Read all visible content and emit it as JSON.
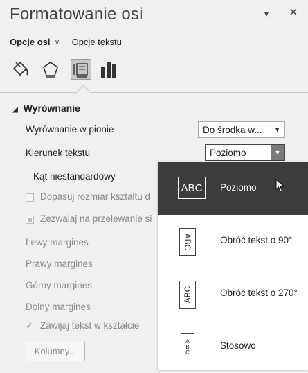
{
  "title": "Formatowanie osi",
  "title_controls": {
    "dropdown_glyph": "▾",
    "close_glyph": "×"
  },
  "tabs": {
    "main": "Opcje osi",
    "secondary": "Opcje tekstu"
  },
  "icons": [
    "fill-line-icon",
    "effects-icon",
    "size-properties-icon",
    "axis-options-icon"
  ],
  "section": {
    "label": "Wyrównanie"
  },
  "fields": {
    "vertical_align": {
      "label": "Wyrównanie w pionie",
      "value": "Do środka w..."
    },
    "text_direction": {
      "label": "Kierunek tekstu",
      "value": "Poziomo"
    },
    "custom_angle": {
      "label": "Kąt niestandardowy"
    }
  },
  "checkboxes": {
    "autofit": {
      "label": "Dopasuj rozmiar kształtu d",
      "checked": false
    },
    "overflow": {
      "label": "Zezwalaj na przelewanie si",
      "state": "indeterminate"
    },
    "wrap": {
      "label": "Zawijaj tekst w kształcie",
      "checked": true
    }
  },
  "margins": {
    "left": "Lewy margines",
    "right": "Prawy margines",
    "top": "Górny margines",
    "bottom": "Dolny margines"
  },
  "columns_button": "Kolumny...",
  "direction_menu": [
    {
      "label": "Poziomo",
      "preview": "ABC",
      "selected": true
    },
    {
      "label": "Obróć tekst o 90°",
      "preview": "ABC"
    },
    {
      "label": "Obróć tekst o 270°",
      "preview": "ABC"
    },
    {
      "label": "Stosowo",
      "preview": "ABC"
    }
  ],
  "colors": {
    "panel_bg": "#f0f0f0",
    "selected_bg": "#3c3c3c",
    "disabled_text": "#8a8a8a"
  }
}
